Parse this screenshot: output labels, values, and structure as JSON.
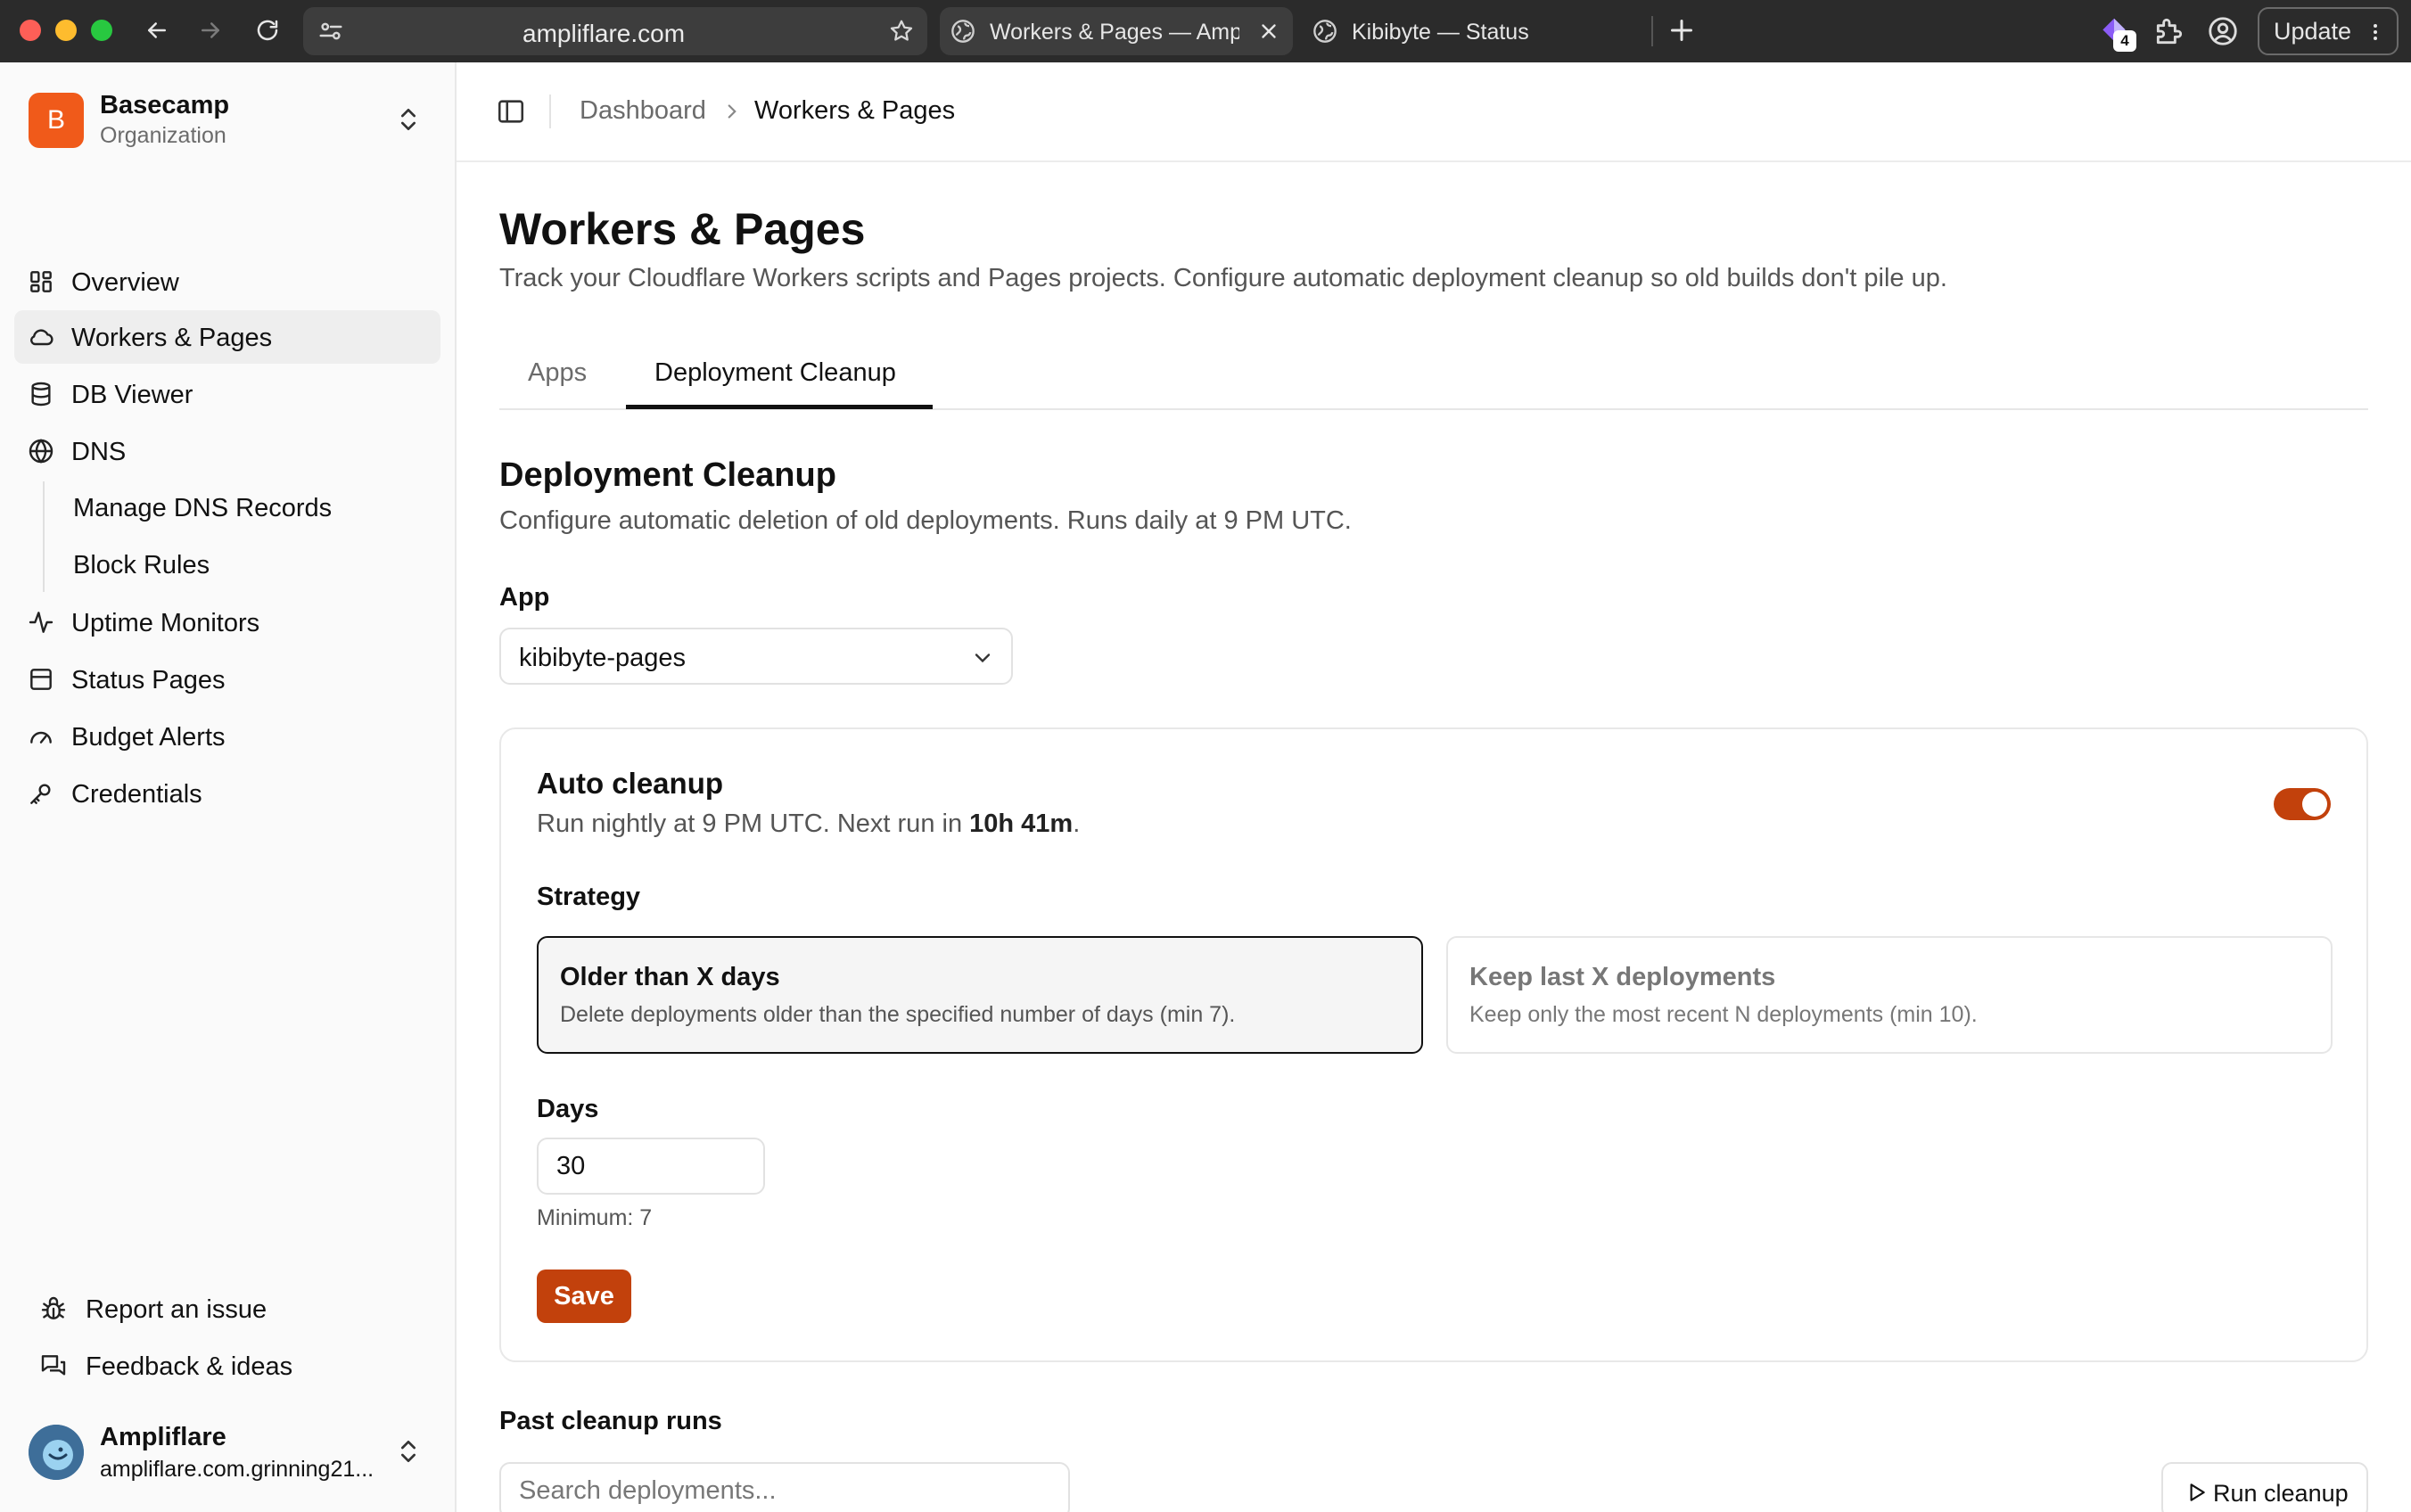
{
  "browser": {
    "url": "ampliflare.com",
    "tabs": [
      {
        "title": "Workers & Pages — Ampliflare"
      },
      {
        "title": "Kibibyte — Status"
      }
    ],
    "extension_badge": "4",
    "update_label": "Update"
  },
  "sidebar": {
    "org": {
      "initial": "B",
      "name": "Basecamp",
      "subtitle": "Organization",
      "avatar_color": "#f05a1a"
    },
    "items": [
      {
        "label": "Overview",
        "icon": "grid-icon"
      },
      {
        "label": "Workers & Pages",
        "icon": "cloud-icon",
        "selected": true
      },
      {
        "label": "DB Viewer",
        "icon": "database-icon"
      },
      {
        "label": "DNS",
        "icon": "globe-icon"
      },
      {
        "label": "Manage DNS Records",
        "sub": true
      },
      {
        "label": "Block Rules",
        "sub": true
      },
      {
        "label": "Uptime Monitors",
        "icon": "activity-icon"
      },
      {
        "label": "Status Pages",
        "icon": "layout-icon"
      },
      {
        "label": "Budget Alerts",
        "icon": "gauge-icon"
      },
      {
        "label": "Credentials",
        "icon": "key-icon"
      }
    ],
    "bottom": [
      {
        "label": "Report an issue",
        "icon": "bug-icon"
      },
      {
        "label": "Feedback & ideas",
        "icon": "chat-icon"
      }
    ],
    "user": {
      "name": "Ampliflare",
      "email": "ampliflare.com.grinning21..."
    }
  },
  "header": {
    "breadcrumb": [
      "Dashboard",
      "Workers & Pages"
    ]
  },
  "main": {
    "title": "Workers & Pages",
    "subtitle": "Track your Cloudflare Workers scripts and Pages projects. Configure automatic deployment cleanup so old builds don't pile up.",
    "tabs": [
      {
        "label": "Apps",
        "active": false
      },
      {
        "label": "Deployment Cleanup",
        "active": true
      }
    ],
    "section_title": "Deployment Cleanup",
    "section_subtitle": "Configure automatic deletion of old deployments. Runs daily at 9 PM UTC.",
    "app_label": "App",
    "app_value": "kibibyte-pages",
    "card": {
      "title": "Auto cleanup",
      "subtitle_prefix": "Run nightly at 9 PM UTC. Next run in ",
      "next_run": "10h 41m",
      "subtitle_suffix": ".",
      "enabled": true,
      "strategy_label": "Strategy",
      "strategies": [
        {
          "title": "Older than X days",
          "desc": "Delete deployments older than the specified number of days (min 7).",
          "selected": true
        },
        {
          "title": "Keep last X deployments",
          "desc": "Keep only the most recent N deployments (min 10).",
          "selected": false
        }
      ],
      "days_label": "Days",
      "days_value": "30",
      "days_hint": "Minimum: 7",
      "save_label": "Save"
    },
    "past_runs_title": "Past cleanup runs",
    "search_placeholder": "Search deployments...",
    "run_cleanup_label": "Run cleanup"
  },
  "colors": {
    "accent": "#c2410c",
    "org_avatar": "#f05a1a",
    "chrome": "#2b2b2b"
  }
}
